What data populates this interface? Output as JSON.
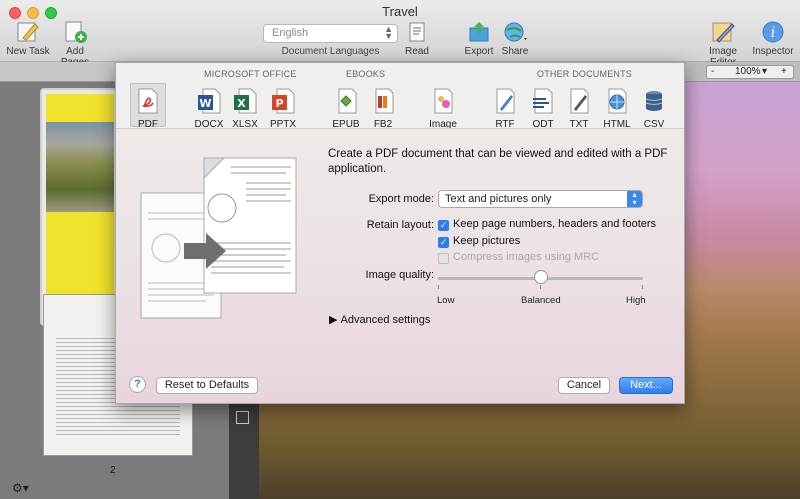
{
  "window": {
    "title": "Travel"
  },
  "toolbar": {
    "new_task": "New Task",
    "add_pages": "Add Pages",
    "language_value": "English",
    "language_caption": "Document Languages",
    "read": "Read",
    "export": "Export",
    "share": "Share",
    "image_editor": "Image Editor",
    "inspector": "Inspector"
  },
  "viewer": {
    "zoom": "100%",
    "zoom_minus": "-",
    "zoom_plus": "+"
  },
  "sidebar": {
    "page_number": "2"
  },
  "export_sheet": {
    "categories": {
      "microsoft_office": "MICROSOFT OFFICE",
      "ebooks": "EBOOKS",
      "other_documents": "OTHER DOCUMENTS"
    },
    "formats": {
      "pdf": "PDF",
      "docx": "DOCX",
      "xlsx": "XLSX",
      "pptx": "PPTX",
      "epub": "EPUB",
      "fb2": "FB2",
      "image": "Image",
      "rtf": "RTF",
      "odt": "ODT",
      "txt": "TXT",
      "html": "HTML",
      "csv": "CSV"
    },
    "description": "Create a PDF document that can be viewed and edited with a PDF application.",
    "export_mode_label": "Export mode:",
    "export_mode_value": "Text and pictures only",
    "retain_layout_label": "Retain layout:",
    "opt_keep_numbers": "Keep page numbers, headers and footers",
    "opt_keep_pictures": "Keep pictures",
    "opt_compress": "Compress images using MRC",
    "image_quality_label": "Image quality:",
    "image_quality_value": 0.5,
    "quality_low": "Low",
    "quality_balanced": "Balanced",
    "quality_high": "High",
    "advanced": "Advanced settings",
    "reset": "Reset to Defaults",
    "help": "?",
    "cancel": "Cancel",
    "next": "Next..."
  },
  "colors": {
    "accent": "#2d7cf2",
    "pdf_red": "#e0312b",
    "word_blue": "#2b5797",
    "excel_green": "#1e7145",
    "pptx_orange": "#d24726"
  }
}
